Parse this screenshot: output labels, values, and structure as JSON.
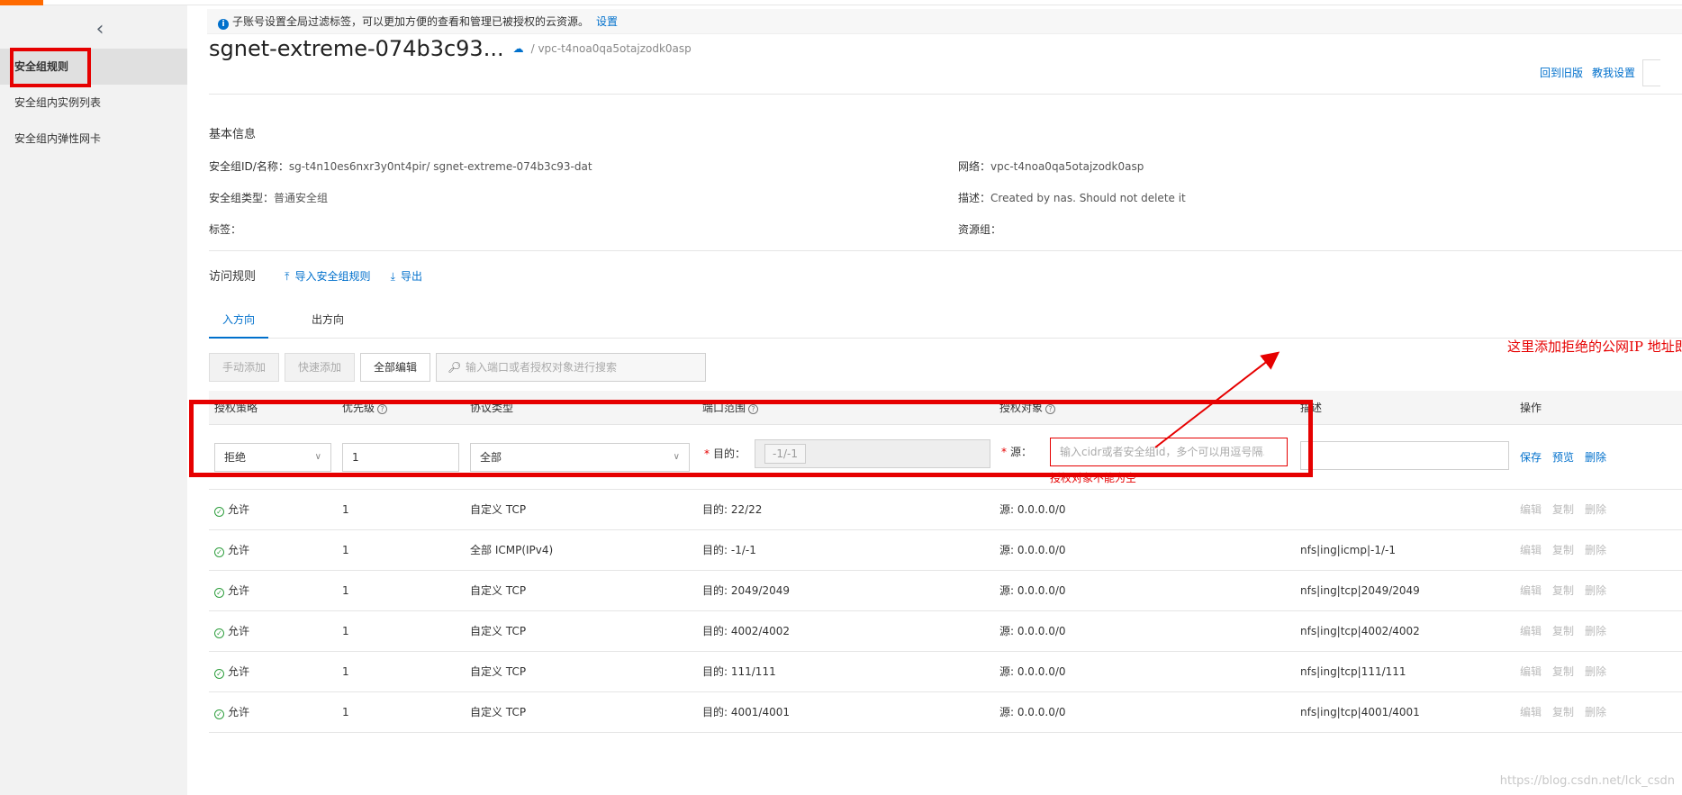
{
  "sidebar": {
    "items": [
      {
        "label": "安全组规则",
        "active": true
      },
      {
        "label": "安全组内实例列表"
      },
      {
        "label": "安全组内弹性网卡"
      }
    ]
  },
  "notice": {
    "text": "子账号设置全局过滤标签，可以更加方便的查看和管理已被授权的云资源。",
    "link": "设置"
  },
  "header": {
    "title": "sgnet-extreme-074b3c93...",
    "vpc": "/ vpc-t4noa0qa5otajzodk0asp",
    "links": [
      "回到旧版",
      "教我设置"
    ]
  },
  "basic_info": {
    "title": "基本信息",
    "id_label": "安全组ID/名称：",
    "id_value": "sg-t4n10es6nxr3y0nt4pir/ sgnet-extreme-074b3c93-dat",
    "type_label": "安全组类型：",
    "type_value": "普通安全组",
    "tags_label": "标签：",
    "network_label": "网络：",
    "network_value": "vpc-t4noa0qa5otajzodk0asp",
    "desc_label": "描述：",
    "desc_value": "Created by nas. Should not delete it",
    "rg_label": "资源组："
  },
  "rules": {
    "title": "访问规则",
    "import_label": "导入安全组规则",
    "export_label": "导出",
    "tabs": [
      "入方向",
      "出方向"
    ],
    "toolbar": {
      "manual_add": "手动添加",
      "quick_add": "快速添加",
      "edit_all": "全部编辑",
      "search_placeholder": "输入端口或者授权对象进行搜索"
    },
    "columns": [
      "授权策略",
      "优先级",
      "协议类型",
      "端口范围",
      "授权对象",
      "描述",
      "操作"
    ],
    "edit_row": {
      "policy": "拒绝",
      "priority": "1",
      "protocol": "全部",
      "dest_label": "目的：",
      "dest_value": "-1/-1",
      "source_label": "源：",
      "source_placeholder": "输入cidr或者安全组id，多个可以用逗号隔...",
      "error": "授权对象不能为空",
      "ops": [
        "保存",
        "预览",
        "删除"
      ]
    },
    "row_actions": [
      "编辑",
      "复制",
      "删除"
    ],
    "rows": [
      {
        "policy": "允许",
        "priority": "1",
        "protocol": "自定义 TCP",
        "port": "目的: 22/22",
        "source": "源: 0.0.0.0/0",
        "desc": ""
      },
      {
        "policy": "允许",
        "priority": "1",
        "protocol": "全部 ICMP(IPv4)",
        "port": "目的: -1/-1",
        "source": "源: 0.0.0.0/0",
        "desc": "nfs|ing|icmp|-1/-1"
      },
      {
        "policy": "允许",
        "priority": "1",
        "protocol": "自定义 TCP",
        "port": "目的: 2049/2049",
        "source": "源: 0.0.0.0/0",
        "desc": "nfs|ing|tcp|2049/2049"
      },
      {
        "policy": "允许",
        "priority": "1",
        "protocol": "自定义 TCP",
        "port": "目的: 4002/4002",
        "source": "源: 0.0.0.0/0",
        "desc": "nfs|ing|tcp|4002/4002"
      },
      {
        "policy": "允许",
        "priority": "1",
        "protocol": "自定义 TCP",
        "port": "目的: 111/111",
        "source": "源: 0.0.0.0/0",
        "desc": "nfs|ing|tcp|111/111"
      },
      {
        "policy": "允许",
        "priority": "1",
        "protocol": "自定义 TCP",
        "port": "目的: 4001/4001",
        "source": "源: 0.0.0.0/0",
        "desc": "nfs|ing|tcp|4001/4001"
      }
    ]
  },
  "annotation": "这里添加拒绝的公网IP 地址即可",
  "watermark": "https://blog.csdn.net/lck_csdn",
  "colors": {
    "accent": "#0070cc",
    "annotation": "#e60000",
    "allow": "#2e9e3e",
    "brand": "#ff6a00"
  }
}
